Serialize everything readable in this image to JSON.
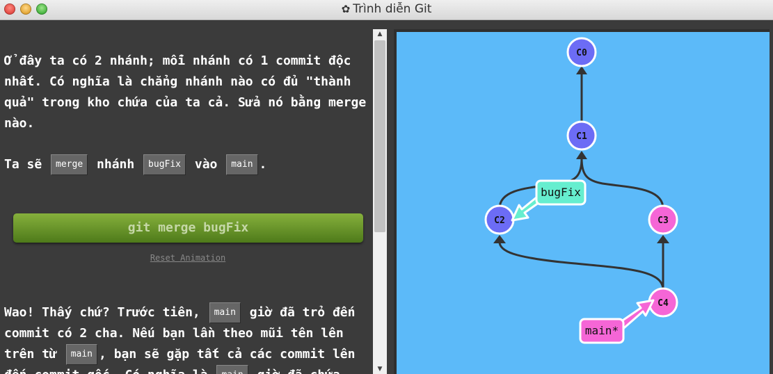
{
  "window": {
    "title": "Trình diễn Git",
    "icon": "gear-icon"
  },
  "colors": {
    "panel_bg": "#3b3b3b",
    "viz_bg": "#5cbaf9",
    "commit_blue": "#6c6cf5",
    "commit_pink": "#f566d6",
    "branch_bugfix_bg": "#66eecf",
    "branch_main_bg": "#f566d6",
    "button_green": "#6a9a2a"
  },
  "text": {
    "para1": "Ở đây ta có 2 nhánh; mỗi nhánh có 1 commit độc nhất. Có nghĩa là chẳng nhánh nào có đủ \"thành quả\" trong kho chứa của ta cả. Sửa nó bằng merge nào.",
    "para2": {
      "part1": "Ta sẽ",
      "chip1": "merge",
      "part2": "nhánh",
      "chip2": "bugFix",
      "part3": "vào",
      "chip3": "main",
      "part4": "."
    },
    "command_button": "git merge bugFix",
    "reset_link": "Reset Animation",
    "para3": {
      "part1": "Wao! Thấy chứ? Trước tiên,",
      "chip1": "main",
      "part2": "giờ đã trỏ đến commit có 2 cha. Nếu bạn lần theo mũi tên lên trên từ",
      "chip2": "main",
      "part3": ", bạn sẽ gặp tất cả các commit lên đến commit gốc. Có nghĩa là",
      "chip3": "main",
      "part4": "giờ đã chứa"
    }
  },
  "graph": {
    "commits": [
      {
        "id": "C0",
        "label": "C0"
      },
      {
        "id": "C1",
        "label": "C1"
      },
      {
        "id": "C2",
        "label": "C2"
      },
      {
        "id": "C3",
        "label": "C3"
      },
      {
        "id": "C4",
        "label": "C4"
      }
    ],
    "branches": [
      {
        "name": "bugFix",
        "points_to": "C2"
      },
      {
        "name": "main*",
        "points_to": "C4"
      }
    ]
  }
}
